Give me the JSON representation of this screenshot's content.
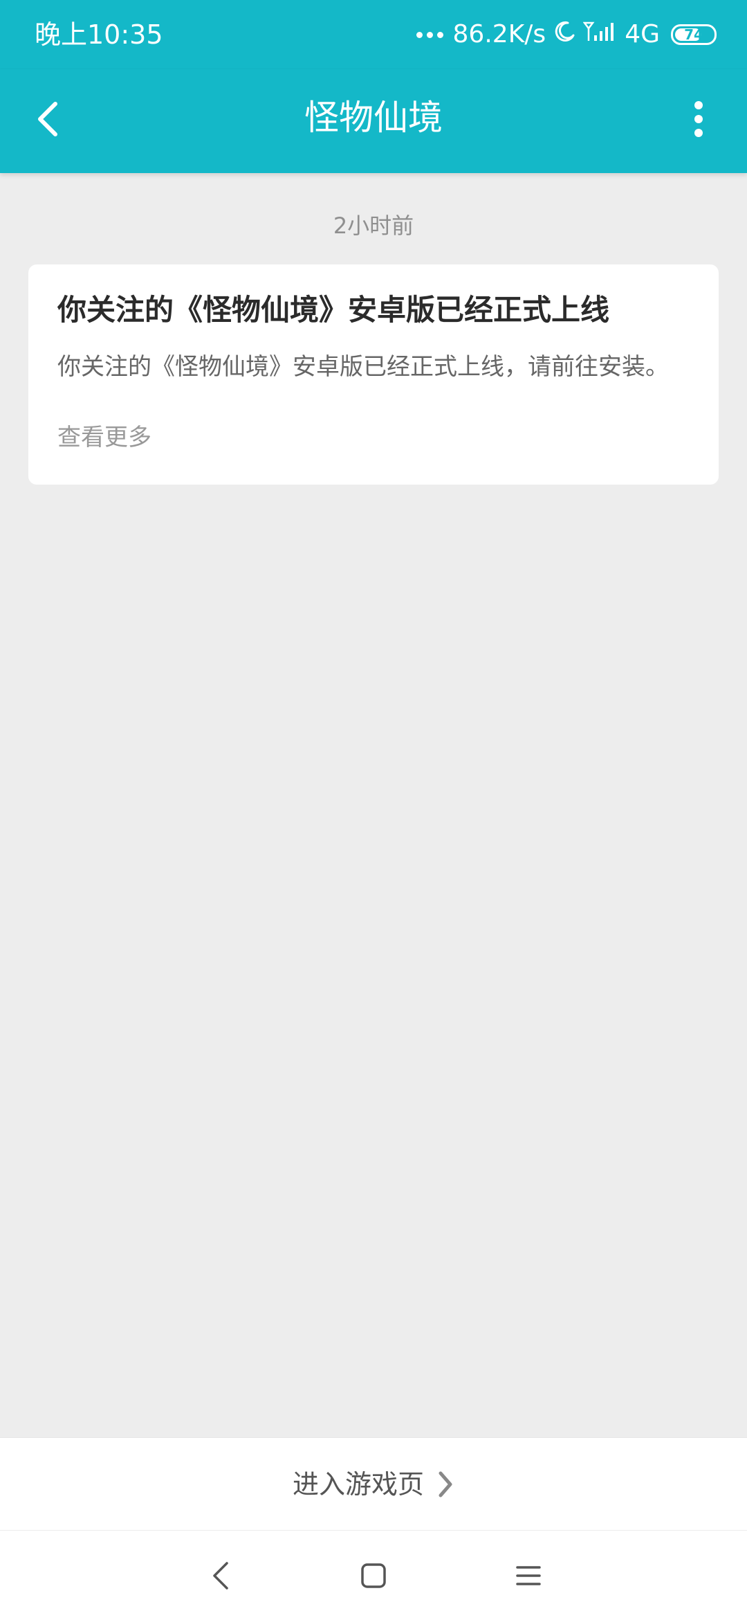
{
  "status_bar": {
    "time": "晚上10:35",
    "network_speed": "86.2K/s",
    "network_type": "4G",
    "battery_level": "74",
    "battery_fraction": 0.74,
    "icons": [
      "more-dots-icon",
      "moon-icon",
      "signal-icon",
      "battery-icon"
    ]
  },
  "app_bar": {
    "title": "怪物仙境",
    "back_icon": "chevron-left-icon",
    "menu_icon": "more-vertical-icon"
  },
  "message": {
    "timestamp": "2小时前",
    "title": "你关注的《怪物仙境》安卓版已经正式上线",
    "body": "你关注的《怪物仙境》安卓版已经正式上线，请前往安装。",
    "more_link": "查看更多"
  },
  "bottom_action": {
    "label": "进入游戏页",
    "icon": "chevron-right-icon"
  },
  "nav_bar": {
    "icons": [
      "nav-back-icon",
      "nav-home-icon",
      "nav-recents-icon"
    ]
  },
  "colors": {
    "header": "#14b8c8",
    "background": "#ededed",
    "card": "#ffffff",
    "title_text": "#2b2b2b",
    "body_text": "#666666",
    "muted_text": "#999999"
  }
}
